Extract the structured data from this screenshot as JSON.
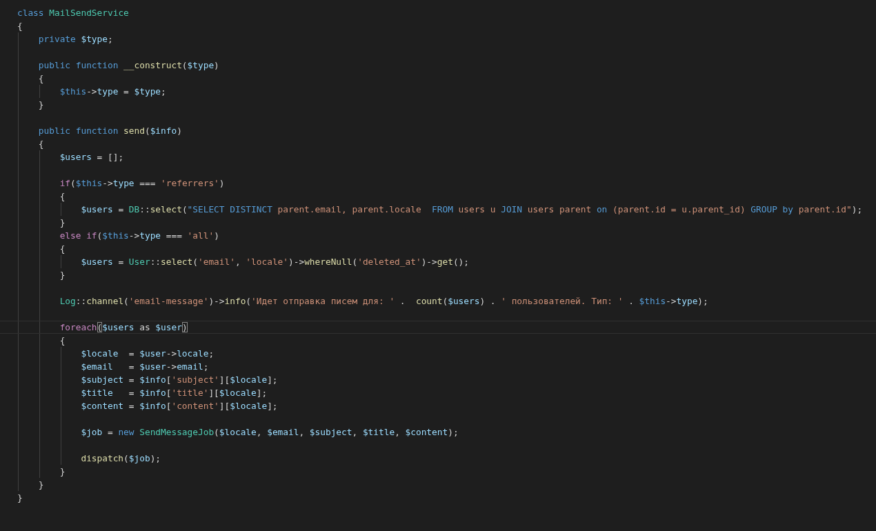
{
  "editor": {
    "lines": [
      {
        "kind": "code",
        "tokens": [
          {
            "text": "class",
            "kind": "kw",
            "space_after": true
          },
          {
            "text": "MailSendService",
            "kind": "cls"
          }
        ]
      },
      {
        "kind": "code",
        "tokens": [
          {
            "text": "{",
            "kind": "plain"
          }
        ],
        "children": [
          {
            "kind": "code",
            "tokens": [
              {
                "text": "private",
                "kind": "kw",
                "space_after": true
              },
              {
                "text": "$type",
                "kind": "var"
              },
              {
                "text": ";",
                "kind": "plain"
              }
            ]
          },
          {
            "kind": "blank"
          },
          {
            "kind": "code",
            "tokens": [
              {
                "text": "public",
                "kind": "kw",
                "space_after": true
              },
              {
                "text": "function",
                "kind": "kw",
                "space_after": true
              },
              {
                "text": "__construct",
                "kind": "fn"
              },
              {
                "text": "(",
                "kind": "plain"
              },
              {
                "text": "$type",
                "kind": "var"
              },
              {
                "text": ")",
                "kind": "plain"
              }
            ]
          },
          {
            "kind": "code",
            "tokens": [
              {
                "text": "{",
                "kind": "plain"
              }
            ],
            "children": [
              {
                "kind": "code",
                "tokens": [
                  {
                    "text": "$this",
                    "kind": "this"
                  },
                  {
                    "text": "->",
                    "kind": "plain"
                  },
                  {
                    "text": "type",
                    "kind": "var"
                  },
                  {
                    "text": " = ",
                    "kind": "plain"
                  },
                  {
                    "text": "$type",
                    "kind": "var"
                  },
                  {
                    "text": ";",
                    "kind": "plain"
                  }
                ]
              }
            ]
          },
          {
            "kind": "code",
            "tokens": [
              {
                "text": "}",
                "kind": "plain"
              }
            ]
          },
          {
            "kind": "blank"
          },
          {
            "kind": "code",
            "tokens": [
              {
                "text": "public",
                "kind": "kw",
                "space_after": true
              },
              {
                "text": "function",
                "kind": "kw",
                "space_after": true
              },
              {
                "text": "send",
                "kind": "fn"
              },
              {
                "text": "(",
                "kind": "plain"
              },
              {
                "text": "$info",
                "kind": "var"
              },
              {
                "text": ")",
                "kind": "plain"
              }
            ]
          },
          {
            "kind": "code",
            "tokens": [
              {
                "text": "{",
                "kind": "plain"
              }
            ],
            "children": [
              {
                "kind": "code",
                "tokens": [
                  {
                    "text": "$users",
                    "kind": "var"
                  },
                  {
                    "text": " = [];",
                    "kind": "plain"
                  }
                ]
              },
              {
                "kind": "blank"
              },
              {
                "kind": "code",
                "tokens": [
                  {
                    "text": "if",
                    "kind": "ctrl"
                  },
                  {
                    "text": "(",
                    "kind": "plain"
                  },
                  {
                    "text": "$this",
                    "kind": "this"
                  },
                  {
                    "text": "->",
                    "kind": "plain"
                  },
                  {
                    "text": "type",
                    "kind": "var"
                  },
                  {
                    "text": " === ",
                    "kind": "plain"
                  },
                  {
                    "text": "'referrers'",
                    "kind": "str"
                  },
                  {
                    "text": ")",
                    "kind": "plain"
                  }
                ]
              },
              {
                "kind": "code",
                "tokens": [
                  {
                    "text": "{",
                    "kind": "plain"
                  }
                ],
                "children": [
                  {
                    "kind": "code",
                    "tokens": [
                      {
                        "text": "$users",
                        "kind": "var"
                      },
                      {
                        "text": " = ",
                        "kind": "plain"
                      },
                      {
                        "text": "DB",
                        "kind": "cls"
                      },
                      {
                        "text": "::",
                        "kind": "plain"
                      },
                      {
                        "text": "select",
                        "kind": "fn"
                      },
                      {
                        "text": "(",
                        "kind": "plain"
                      },
                      {
                        "text": "\"SELECT DISTINCT",
                        "kind": "kw"
                      },
                      {
                        "text": " parent.email, parent.locale  ",
                        "kind": "str"
                      },
                      {
                        "text": "FROM",
                        "kind": "kw"
                      },
                      {
                        "text": " users u ",
                        "kind": "str"
                      },
                      {
                        "text": "JOIN",
                        "kind": "kw"
                      },
                      {
                        "text": " users parent ",
                        "kind": "str"
                      },
                      {
                        "text": "on",
                        "kind": "kw"
                      },
                      {
                        "text": " (parent.id = u.parent_id) ",
                        "kind": "str"
                      },
                      {
                        "text": "GROUP by",
                        "kind": "kw"
                      },
                      {
                        "text": " parent.id\"",
                        "kind": "str"
                      },
                      {
                        "text": ");",
                        "kind": "plain"
                      }
                    ]
                  }
                ]
              },
              {
                "kind": "code",
                "tokens": [
                  {
                    "text": "}",
                    "kind": "plain"
                  }
                ]
              },
              {
                "kind": "code",
                "tokens": [
                  {
                    "text": "else",
                    "kind": "ctrl",
                    "space_after": true
                  },
                  {
                    "text": "if",
                    "kind": "ctrl"
                  },
                  {
                    "text": "(",
                    "kind": "plain"
                  },
                  {
                    "text": "$this",
                    "kind": "this"
                  },
                  {
                    "text": "->",
                    "kind": "plain"
                  },
                  {
                    "text": "type",
                    "kind": "var"
                  },
                  {
                    "text": " === ",
                    "kind": "plain"
                  },
                  {
                    "text": "'all'",
                    "kind": "str"
                  },
                  {
                    "text": ")",
                    "kind": "plain"
                  }
                ]
              },
              {
                "kind": "code",
                "tokens": [
                  {
                    "text": "{",
                    "kind": "plain"
                  }
                ],
                "children": [
                  {
                    "kind": "code",
                    "tokens": [
                      {
                        "text": "$users",
                        "kind": "var"
                      },
                      {
                        "text": " = ",
                        "kind": "plain"
                      },
                      {
                        "text": "User",
                        "kind": "cls"
                      },
                      {
                        "text": "::",
                        "kind": "plain"
                      },
                      {
                        "text": "select",
                        "kind": "fn"
                      },
                      {
                        "text": "(",
                        "kind": "plain"
                      },
                      {
                        "text": "'email'",
                        "kind": "str"
                      },
                      {
                        "text": ", ",
                        "kind": "plain"
                      },
                      {
                        "text": "'locale'",
                        "kind": "str"
                      },
                      {
                        "text": ")->",
                        "kind": "plain"
                      },
                      {
                        "text": "whereNull",
                        "kind": "fn"
                      },
                      {
                        "text": "(",
                        "kind": "plain"
                      },
                      {
                        "text": "'deleted_at'",
                        "kind": "str"
                      },
                      {
                        "text": ")->",
                        "kind": "plain"
                      },
                      {
                        "text": "get",
                        "kind": "fn"
                      },
                      {
                        "text": "();",
                        "kind": "plain"
                      }
                    ]
                  }
                ]
              },
              {
                "kind": "code",
                "tokens": [
                  {
                    "text": "}",
                    "kind": "plain"
                  }
                ]
              },
              {
                "kind": "blank"
              },
              {
                "kind": "code",
                "tokens": [
                  {
                    "text": "Log",
                    "kind": "cls"
                  },
                  {
                    "text": "::",
                    "kind": "plain"
                  },
                  {
                    "text": "channel",
                    "kind": "fn"
                  },
                  {
                    "text": "(",
                    "kind": "plain"
                  },
                  {
                    "text": "'email-message'",
                    "kind": "str"
                  },
                  {
                    "text": ")->",
                    "kind": "plain"
                  },
                  {
                    "text": "info",
                    "kind": "fn"
                  },
                  {
                    "text": "(",
                    "kind": "plain"
                  },
                  {
                    "text": "'Идет отправка писем для: '",
                    "kind": "str"
                  },
                  {
                    "text": " .  ",
                    "kind": "plain"
                  },
                  {
                    "text": "count",
                    "kind": "fn"
                  },
                  {
                    "text": "(",
                    "kind": "plain"
                  },
                  {
                    "text": "$users",
                    "kind": "var"
                  },
                  {
                    "text": ") . ",
                    "kind": "plain"
                  },
                  {
                    "text": "' пользователей. Тип: '",
                    "kind": "str"
                  },
                  {
                    "text": " . ",
                    "kind": "plain"
                  },
                  {
                    "text": "$this",
                    "kind": "this"
                  },
                  {
                    "text": "->",
                    "kind": "plain"
                  },
                  {
                    "text": "type",
                    "kind": "var"
                  },
                  {
                    "text": ");",
                    "kind": "plain"
                  }
                ]
              },
              {
                "kind": "blank"
              },
              {
                "kind": "code",
                "current": true,
                "tokens": [
                  {
                    "text": "foreach",
                    "kind": "ctrl"
                  },
                  {
                    "text": "(",
                    "kind": "match"
                  },
                  {
                    "text": "$users",
                    "kind": "var"
                  },
                  {
                    "text": " as ",
                    "kind": "plain"
                  },
                  {
                    "text": "$user",
                    "kind": "var"
                  },
                  {
                    "text": ")",
                    "kind": "match"
                  }
                ]
              },
              {
                "kind": "code",
                "tokens": [
                  {
                    "text": "{",
                    "kind": "plain"
                  }
                ],
                "children": [
                  {
                    "kind": "code",
                    "tokens": [
                      {
                        "text": "$locale",
                        "kind": "var"
                      },
                      {
                        "text": "  = ",
                        "kind": "plain"
                      },
                      {
                        "text": "$user",
                        "kind": "var"
                      },
                      {
                        "text": "->",
                        "kind": "plain"
                      },
                      {
                        "text": "locale",
                        "kind": "var"
                      },
                      {
                        "text": ";",
                        "kind": "plain"
                      }
                    ]
                  },
                  {
                    "kind": "code",
                    "tokens": [
                      {
                        "text": "$email",
                        "kind": "var"
                      },
                      {
                        "text": "   = ",
                        "kind": "plain"
                      },
                      {
                        "text": "$user",
                        "kind": "var"
                      },
                      {
                        "text": "->",
                        "kind": "plain"
                      },
                      {
                        "text": "email",
                        "kind": "var"
                      },
                      {
                        "text": ";",
                        "kind": "plain"
                      }
                    ]
                  },
                  {
                    "kind": "code",
                    "tokens": [
                      {
                        "text": "$subject",
                        "kind": "var"
                      },
                      {
                        "text": " = ",
                        "kind": "plain"
                      },
                      {
                        "text": "$info",
                        "kind": "var"
                      },
                      {
                        "text": "[",
                        "kind": "plain"
                      },
                      {
                        "text": "'subject'",
                        "kind": "str"
                      },
                      {
                        "text": "][",
                        "kind": "plain"
                      },
                      {
                        "text": "$locale",
                        "kind": "var"
                      },
                      {
                        "text": "];",
                        "kind": "plain"
                      }
                    ]
                  },
                  {
                    "kind": "code",
                    "tokens": [
                      {
                        "text": "$title",
                        "kind": "var"
                      },
                      {
                        "text": "   = ",
                        "kind": "plain"
                      },
                      {
                        "text": "$info",
                        "kind": "var"
                      },
                      {
                        "text": "[",
                        "kind": "plain"
                      },
                      {
                        "text": "'title'",
                        "kind": "str"
                      },
                      {
                        "text": "][",
                        "kind": "plain"
                      },
                      {
                        "text": "$locale",
                        "kind": "var"
                      },
                      {
                        "text": "];",
                        "kind": "plain"
                      }
                    ]
                  },
                  {
                    "kind": "code",
                    "tokens": [
                      {
                        "text": "$content",
                        "kind": "var"
                      },
                      {
                        "text": " = ",
                        "kind": "plain"
                      },
                      {
                        "text": "$info",
                        "kind": "var"
                      },
                      {
                        "text": "[",
                        "kind": "plain"
                      },
                      {
                        "text": "'content'",
                        "kind": "str"
                      },
                      {
                        "text": "][",
                        "kind": "plain"
                      },
                      {
                        "text": "$locale",
                        "kind": "var"
                      },
                      {
                        "text": "];",
                        "kind": "plain"
                      }
                    ]
                  },
                  {
                    "kind": "blank"
                  },
                  {
                    "kind": "code",
                    "tokens": [
                      {
                        "text": "$job",
                        "kind": "var"
                      },
                      {
                        "text": " = ",
                        "kind": "plain"
                      },
                      {
                        "text": "new",
                        "kind": "kw",
                        "space_after": true
                      },
                      {
                        "text": "SendMessageJob",
                        "kind": "cls"
                      },
                      {
                        "text": "(",
                        "kind": "plain"
                      },
                      {
                        "text": "$locale",
                        "kind": "var"
                      },
                      {
                        "text": ", ",
                        "kind": "plain"
                      },
                      {
                        "text": "$email",
                        "kind": "var"
                      },
                      {
                        "text": ", ",
                        "kind": "plain"
                      },
                      {
                        "text": "$subject",
                        "kind": "var"
                      },
                      {
                        "text": ", ",
                        "kind": "plain"
                      },
                      {
                        "text": "$title",
                        "kind": "var"
                      },
                      {
                        "text": ", ",
                        "kind": "plain"
                      },
                      {
                        "text": "$content",
                        "kind": "var"
                      },
                      {
                        "text": ");",
                        "kind": "plain"
                      }
                    ]
                  },
                  {
                    "kind": "blank"
                  },
                  {
                    "kind": "code",
                    "tokens": [
                      {
                        "text": "dispatch",
                        "kind": "fn"
                      },
                      {
                        "text": "(",
                        "kind": "plain"
                      },
                      {
                        "text": "$job",
                        "kind": "var"
                      },
                      {
                        "text": ");",
                        "kind": "plain"
                      }
                    ]
                  }
                ]
              },
              {
                "kind": "code",
                "tokens": [
                  {
                    "text": "}",
                    "kind": "plain"
                  }
                ]
              }
            ]
          },
          {
            "kind": "code",
            "tokens": [
              {
                "text": "}",
                "kind": "plain"
              }
            ]
          }
        ]
      },
      {
        "kind": "code",
        "tokens": [
          {
            "text": "}",
            "kind": "plain"
          }
        ]
      }
    ]
  }
}
